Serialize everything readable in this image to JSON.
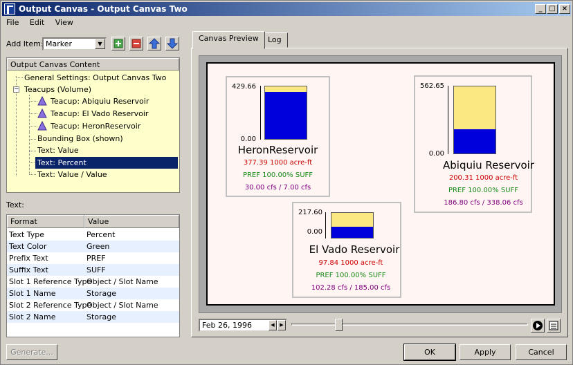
{
  "window": {
    "title": "Output Canvas - Output Canvas Two"
  },
  "menu": [
    "File",
    "Edit",
    "View"
  ],
  "add_item": {
    "label": "Add Item:",
    "selected": "Marker"
  },
  "tree": {
    "header": "Output Canvas Content",
    "items": [
      {
        "label": "General Settings: Output Canvas Two"
      },
      {
        "label": "Teacups (Volume)"
      },
      {
        "label": "Teacup: Abiquiu Reservoir"
      },
      {
        "label": "Teacup: El Vado Reservoir"
      },
      {
        "label": "Teacup: HeronReservoir"
      },
      {
        "label": "Bounding Box (shown)"
      },
      {
        "label": "Text: Value"
      },
      {
        "label": "Text: Percent",
        "selected": true
      },
      {
        "label": "Text: Value / Value"
      }
    ]
  },
  "text_section_label": "Text:",
  "grid": {
    "columns": [
      "Format",
      "Value"
    ],
    "rows": [
      [
        "Text Type",
        "Percent"
      ],
      [
        "Text Color",
        "Green"
      ],
      [
        "Prefix Text",
        "PREF"
      ],
      [
        "Suffix Text",
        "SUFF"
      ],
      [
        "Slot 1 Reference Type",
        "Object / Slot Name"
      ],
      [
        "Slot 1 Name",
        "Storage"
      ],
      [
        "Slot 2 Reference Type",
        "Object / Slot Name"
      ],
      [
        "Slot 2 Name",
        "Storage"
      ]
    ]
  },
  "generate_label": "Generate...",
  "tabs": [
    "Canvas Preview",
    "Log"
  ],
  "teacups": {
    "heron": {
      "max": "429.66",
      "min": "0.00",
      "fill_fraction": 0.9,
      "name": "HeronReservoir",
      "line1": "377.39 1000 acre-ft",
      "line2": "PREF 100.00% SUFF",
      "line3": "30.00 cfs / 7.00 cfs"
    },
    "abiquiu": {
      "max": "562.65",
      "min": "0.00",
      "fill_fraction": 0.36,
      "name": "Abiquiu Reservoir",
      "line1": "200.31 1000 acre-ft",
      "line2": "PREF 100.00% SUFF",
      "line3": "186.80 cfs / 338.06 cfs"
    },
    "elvado": {
      "max": "217.60",
      "min": "0.00",
      "fill_fraction": 0.45,
      "name": "El Vado Reservoir",
      "line1": "97.84 1000 acre-ft",
      "line2": "PREF 100.00% SUFF",
      "line3": "102.28 cfs / 185.00 cfs"
    }
  },
  "date": "Feb 26, 1996",
  "slider_fraction": 0.2,
  "buttons": {
    "ok": "OK",
    "apply": "Apply",
    "cancel": "Cancel"
  },
  "colors": {
    "fill": "#0000dd",
    "cup": "#fce882",
    "canvas_bg": "#fff5f2",
    "value_text": "#cc0000",
    "percent_text": "#1a8a1a",
    "flow_text": "#800080"
  }
}
